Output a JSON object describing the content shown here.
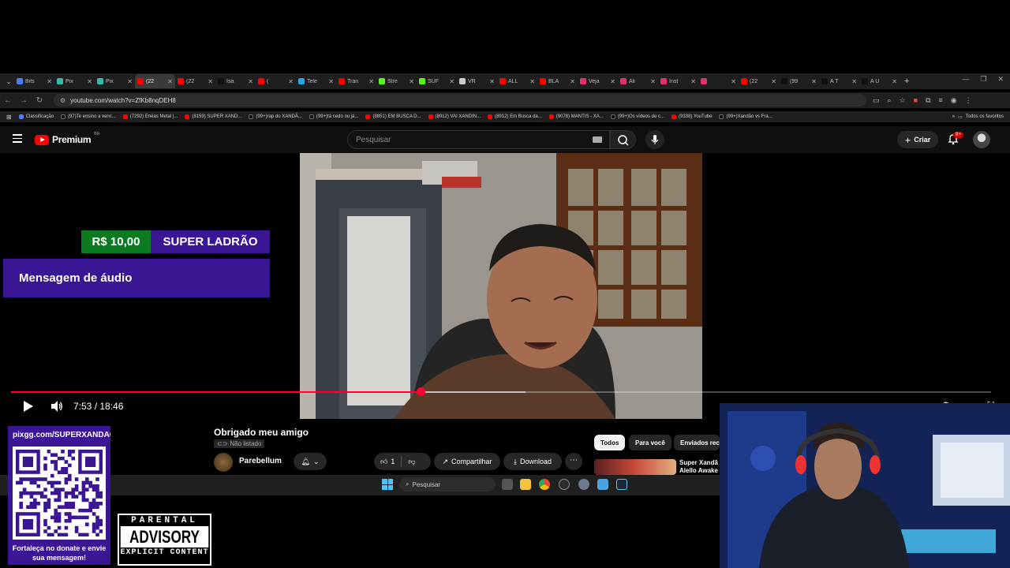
{
  "browser": {
    "tabs": [
      {
        "label": "Bits",
        "color": "#4a7cf7"
      },
      {
        "label": "Pix",
        "color": "#32bcad"
      },
      {
        "label": "Pix",
        "color": "#32bcad"
      },
      {
        "label": "(22",
        "color": "#ff0000",
        "active": true
      },
      {
        "label": "(22",
        "color": "#ff0000"
      },
      {
        "label": "Isa",
        "color": "#111111"
      },
      {
        "label": "(",
        "color": "#ff0000"
      },
      {
        "label": "Tele",
        "color": "#2aa3ef"
      },
      {
        "label": "Tran",
        "color": "#ff0000"
      },
      {
        "label": "Stre",
        "color": "#53fc18"
      },
      {
        "label": "SUF",
        "color": "#53fc18"
      },
      {
        "label": "VR",
        "color": "#cccccc"
      },
      {
        "label": "ALL",
        "color": "#ff0000"
      },
      {
        "label": "BLA",
        "color": "#ff0000"
      },
      {
        "label": "Veja",
        "color": "#e1306c"
      },
      {
        "label": "Ali",
        "color": "#e1306c"
      },
      {
        "label": "Inst",
        "color": "#e1306c"
      },
      {
        "label": "",
        "color": "#e1306c"
      },
      {
        "label": "(22",
        "color": "#ff0000"
      },
      {
        "label": "(99",
        "color": "#111111"
      },
      {
        "label": "A T",
        "color": "#111111"
      },
      {
        "label": "A U",
        "color": "#111111"
      }
    ],
    "url": "youtube.com/watch?v=ZfKb8nqDEH8",
    "bookmarks": [
      {
        "label": "Classificação",
        "type": "cl"
      },
      {
        "label": "(97)Te ensino a venc...",
        "type": "tt"
      },
      {
        "label": "(7292) Enéas Metal |...",
        "type": "yt"
      },
      {
        "label": "(8159) SUPER XAND...",
        "type": "yt"
      },
      {
        "label": "(99+)rap do XANDÃ...",
        "type": "tt"
      },
      {
        "label": "(99+)tá cedo ou já...",
        "type": "tt"
      },
      {
        "label": "(8851) EM BUSCA D...",
        "type": "yt"
      },
      {
        "label": "(8912) VAI XANDIN...",
        "type": "yt"
      },
      {
        "label": "(8912) Em Busca da...",
        "type": "yt"
      },
      {
        "label": "(9078) MANTIS - XA...",
        "type": "yt"
      },
      {
        "label": "(99+)Os vídeos de c...",
        "type": "tt"
      },
      {
        "label": "(9338) YouTube",
        "type": "yt"
      },
      {
        "label": "(99+)Xandão vs Fra...",
        "type": "tt"
      }
    ],
    "all_favorites": "Todos os favoritos"
  },
  "youtube": {
    "logo_text": "Premium",
    "region": "BR",
    "search_placeholder": "Pesquisar",
    "create_label": "Criar",
    "notif_badge": "9+",
    "video_time": "7:53 / 18:46",
    "progress_fraction": 0.4182,
    "buffer_fraction": 0.525,
    "title": "Obrigado meu amigo",
    "visibility": "Não listado",
    "channel": "Parebellum",
    "likes": "1",
    "share_label": "Compartilhar",
    "download_label": "Download",
    "chips": [
      "Todos",
      "Para você",
      "Enviados rec"
    ],
    "rec_title": "Super Xandã Alello Awake"
  },
  "donation": {
    "amount": "R$ 10,00",
    "donor": "SUPER LADRÃO",
    "message": "Mensagem de áudio"
  },
  "taskbar": {
    "search_label": "Pesquisar"
  },
  "donate_card": {
    "url": "pixgg.com/SUPERXANDAO",
    "cta": "Fortaleça no donate e envie sua mensagem!"
  },
  "parental_advisory": {
    "line1": "PARENTAL",
    "line2": "ADVISORY",
    "line3": "EXPLICIT CONTENT"
  },
  "colors": {
    "accent_red": "#ff0033",
    "donation_purple": "#3a1594",
    "donation_green": "#0c7a20"
  }
}
